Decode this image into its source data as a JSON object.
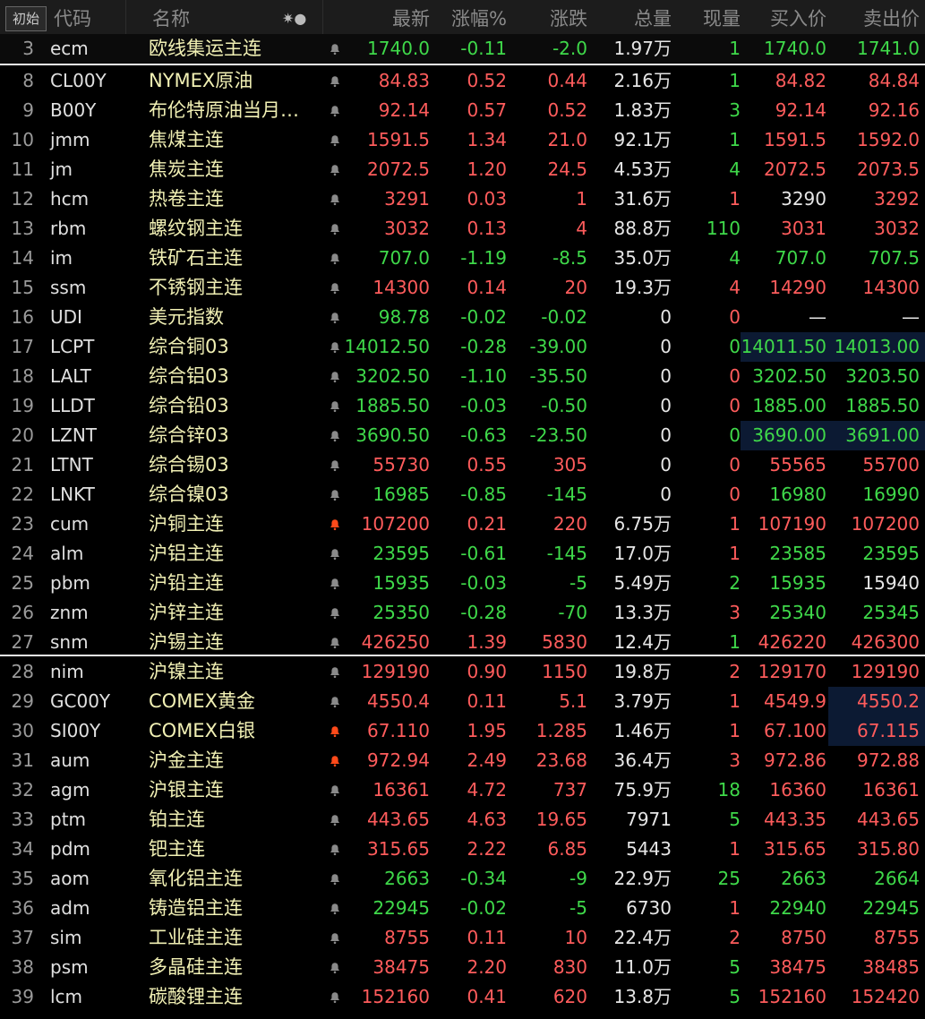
{
  "header": {
    "init_button": "初始",
    "col_code": "代码",
    "col_name": "名称",
    "col_flag": "✷●",
    "col_last": "最新",
    "col_pct": "涨幅%",
    "col_chg": "涨跌",
    "col_vol": "总量",
    "col_curvol": "现量",
    "col_bid": "买入价",
    "col_ask": "卖出价"
  },
  "colors": {
    "up": "#ff5c5c",
    "down": "#3fd94a",
    "name": "#f1f0b4",
    "alert_bell": "#ff4a1a"
  },
  "rows": [
    {
      "idx": "3",
      "code": "ecm",
      "name": "欧线集运主连",
      "bell": "normal",
      "last": "1740.0",
      "pct": "-0.11",
      "chg": "-2.0",
      "vol": "1.97万",
      "cur": "1",
      "bid": "1740.0",
      "ask": "1741.0",
      "c_last": "dn",
      "c_pct": "dn",
      "c_chg": "dn",
      "c_cur": "dn",
      "c_bid": "dn",
      "c_ask": "dn"
    },
    {
      "idx": "8",
      "code": "CL00Y",
      "name": "NYMEX原油",
      "bell": "normal",
      "last": "84.83",
      "pct": "0.52",
      "chg": "0.44",
      "vol": "2.16万",
      "cur": "1",
      "bid": "84.82",
      "ask": "84.84",
      "c_last": "up",
      "c_pct": "up",
      "c_chg": "up",
      "c_cur": "dn",
      "c_bid": "up",
      "c_ask": "up"
    },
    {
      "idx": "9",
      "code": "B00Y",
      "name": "布伦特原油当月…",
      "bell": "normal",
      "last": "92.14",
      "pct": "0.57",
      "chg": "0.52",
      "vol": "1.83万",
      "cur": "3",
      "bid": "92.14",
      "ask": "92.16",
      "c_last": "up",
      "c_pct": "up",
      "c_chg": "up",
      "c_cur": "dn",
      "c_bid": "up",
      "c_ask": "up"
    },
    {
      "idx": "10",
      "code": "jmm",
      "name": "焦煤主连",
      "bell": "normal",
      "last": "1591.5",
      "pct": "1.34",
      "chg": "21.0",
      "vol": "92.1万",
      "cur": "1",
      "bid": "1591.5",
      "ask": "1592.0",
      "c_last": "up",
      "c_pct": "up",
      "c_chg": "up",
      "c_cur": "dn",
      "c_bid": "up",
      "c_ask": "up"
    },
    {
      "idx": "11",
      "code": "jm",
      "name": "焦炭主连",
      "bell": "normal",
      "last": "2072.5",
      "pct": "1.20",
      "chg": "24.5",
      "vol": "4.53万",
      "cur": "4",
      "bid": "2072.5",
      "ask": "2073.5",
      "c_last": "up",
      "c_pct": "up",
      "c_chg": "up",
      "c_cur": "dn",
      "c_bid": "up",
      "c_ask": "up"
    },
    {
      "idx": "12",
      "code": "hcm",
      "name": "热卷主连",
      "bell": "normal",
      "last": "3291",
      "pct": "0.03",
      "chg": "1",
      "vol": "31.6万",
      "cur": "1",
      "bid": "3290",
      "ask": "3292",
      "c_last": "up",
      "c_pct": "up",
      "c_chg": "up",
      "c_cur": "up",
      "c_bid": "wh",
      "c_ask": "up"
    },
    {
      "idx": "13",
      "code": "rbm",
      "name": "螺纹钢主连",
      "bell": "normal",
      "last": "3032",
      "pct": "0.13",
      "chg": "4",
      "vol": "88.8万",
      "cur": "110",
      "bid": "3031",
      "ask": "3032",
      "c_last": "up",
      "c_pct": "up",
      "c_chg": "up",
      "c_cur": "dn",
      "c_bid": "up",
      "c_ask": "up"
    },
    {
      "idx": "14",
      "code": "im",
      "name": "铁矿石主连",
      "bell": "normal",
      "last": "707.0",
      "pct": "-1.19",
      "chg": "-8.5",
      "vol": "35.0万",
      "cur": "4",
      "bid": "707.0",
      "ask": "707.5",
      "c_last": "dn",
      "c_pct": "dn",
      "c_chg": "dn",
      "c_cur": "dn",
      "c_bid": "dn",
      "c_ask": "dn"
    },
    {
      "idx": "15",
      "code": "ssm",
      "name": "不锈钢主连",
      "bell": "normal",
      "last": "14300",
      "pct": "0.14",
      "chg": "20",
      "vol": "19.3万",
      "cur": "4",
      "bid": "14290",
      "ask": "14300",
      "c_last": "up",
      "c_pct": "up",
      "c_chg": "up",
      "c_cur": "up",
      "c_bid": "up",
      "c_ask": "up"
    },
    {
      "idx": "16",
      "code": "UDI",
      "name": "美元指数",
      "bell": "normal",
      "last": "98.78",
      "pct": "-0.02",
      "chg": "-0.02",
      "vol": "0",
      "cur": "0",
      "bid": "—",
      "ask": "—",
      "c_last": "dn",
      "c_pct": "dn",
      "c_chg": "dn",
      "c_cur": "up",
      "c_bid": "wh",
      "c_ask": "wh"
    },
    {
      "idx": "17",
      "code": "LCPT",
      "name": "综合铜03",
      "bell": "normal",
      "last": "14012.50",
      "pct": "-0.28",
      "chg": "-39.00",
      "vol": "0",
      "cur": "0",
      "bid": "14011.50",
      "ask": "14013.00",
      "c_last": "dn",
      "c_pct": "dn",
      "c_chg": "dn",
      "c_cur": "dn",
      "c_bid": "dn",
      "c_ask": "dn",
      "hl": true
    },
    {
      "idx": "18",
      "code": "LALT",
      "name": "综合铝03",
      "bell": "normal",
      "last": "3202.50",
      "pct": "-1.10",
      "chg": "-35.50",
      "vol": "0",
      "cur": "0",
      "bid": "3202.50",
      "ask": "3203.50",
      "c_last": "dn",
      "c_pct": "dn",
      "c_chg": "dn",
      "c_cur": "up",
      "c_bid": "dn",
      "c_ask": "dn"
    },
    {
      "idx": "19",
      "code": "LLDT",
      "name": "综合铅03",
      "bell": "normal",
      "last": "1885.50",
      "pct": "-0.03",
      "chg": "-0.50",
      "vol": "0",
      "cur": "0",
      "bid": "1885.00",
      "ask": "1885.50",
      "c_last": "dn",
      "c_pct": "dn",
      "c_chg": "dn",
      "c_cur": "up",
      "c_bid": "dn",
      "c_ask": "dn"
    },
    {
      "idx": "20",
      "code": "LZNT",
      "name": "综合锌03",
      "bell": "normal",
      "last": "3690.50",
      "pct": "-0.63",
      "chg": "-23.50",
      "vol": "0",
      "cur": "0",
      "bid": "3690.00",
      "ask": "3691.00",
      "c_last": "dn",
      "c_pct": "dn",
      "c_chg": "dn",
      "c_cur": "dn",
      "c_bid": "dn",
      "c_ask": "dn",
      "hl": true
    },
    {
      "idx": "21",
      "code": "LTNT",
      "name": "综合锡03",
      "bell": "normal",
      "last": "55730",
      "pct": "0.55",
      "chg": "305",
      "vol": "0",
      "cur": "0",
      "bid": "55565",
      "ask": "55700",
      "c_last": "up",
      "c_pct": "up",
      "c_chg": "up",
      "c_cur": "up",
      "c_bid": "up",
      "c_ask": "up"
    },
    {
      "idx": "22",
      "code": "LNKT",
      "name": "综合镍03",
      "bell": "normal",
      "last": "16985",
      "pct": "-0.85",
      "chg": "-145",
      "vol": "0",
      "cur": "0",
      "bid": "16980",
      "ask": "16990",
      "c_last": "dn",
      "c_pct": "dn",
      "c_chg": "dn",
      "c_cur": "up",
      "c_bid": "dn",
      "c_ask": "dn"
    },
    {
      "idx": "23",
      "code": "cum",
      "name": "沪铜主连",
      "bell": "alert",
      "last": "107200",
      "pct": "0.21",
      "chg": "220",
      "vol": "6.75万",
      "cur": "1",
      "bid": "107190",
      "ask": "107200",
      "c_last": "up",
      "c_pct": "up",
      "c_chg": "up",
      "c_cur": "up",
      "c_bid": "up",
      "c_ask": "up"
    },
    {
      "idx": "24",
      "code": "alm",
      "name": "沪铝主连",
      "bell": "normal",
      "last": "23595",
      "pct": "-0.61",
      "chg": "-145",
      "vol": "17.0万",
      "cur": "1",
      "bid": "23585",
      "ask": "23595",
      "c_last": "dn",
      "c_pct": "dn",
      "c_chg": "dn",
      "c_cur": "up",
      "c_bid": "dn",
      "c_ask": "dn"
    },
    {
      "idx": "25",
      "code": "pbm",
      "name": "沪铅主连",
      "bell": "normal",
      "last": "15935",
      "pct": "-0.03",
      "chg": "-5",
      "vol": "5.49万",
      "cur": "2",
      "bid": "15935",
      "ask": "15940",
      "c_last": "dn",
      "c_pct": "dn",
      "c_chg": "dn",
      "c_cur": "dn",
      "c_bid": "dn",
      "c_ask": "wh"
    },
    {
      "idx": "26",
      "code": "znm",
      "name": "沪锌主连",
      "bell": "normal",
      "last": "25350",
      "pct": "-0.28",
      "chg": "-70",
      "vol": "13.3万",
      "cur": "3",
      "bid": "25340",
      "ask": "25345",
      "c_last": "dn",
      "c_pct": "dn",
      "c_chg": "dn",
      "c_cur": "up",
      "c_bid": "dn",
      "c_ask": "dn"
    },
    {
      "idx": "27",
      "code": "snm",
      "name": "沪锡主连",
      "bell": "normal",
      "last": "426250",
      "pct": "1.39",
      "chg": "5830",
      "vol": "12.4万",
      "cur": "1",
      "bid": "426220",
      "ask": "426300",
      "c_last": "up",
      "c_pct": "up",
      "c_chg": "up",
      "c_cur": "dn",
      "c_bid": "up",
      "c_ask": "up"
    },
    {
      "idx": "28",
      "code": "nim",
      "name": "沪镍主连",
      "bell": "normal",
      "last": "129190",
      "pct": "0.90",
      "chg": "1150",
      "vol": "19.8万",
      "cur": "2",
      "bid": "129170",
      "ask": "129190",
      "c_last": "up",
      "c_pct": "up",
      "c_chg": "up",
      "c_cur": "up",
      "c_bid": "up",
      "c_ask": "up"
    },
    {
      "idx": "29",
      "code": "GC00Y",
      "name": "COMEX黄金",
      "bell": "normal",
      "last": "4550.4",
      "pct": "0.11",
      "chg": "5.1",
      "vol": "3.79万",
      "cur": "1",
      "bid": "4549.9",
      "ask": "4550.2",
      "c_last": "up",
      "c_pct": "up",
      "c_chg": "up",
      "c_cur": "up",
      "c_bid": "up",
      "c_ask": "up",
      "hl_ask": true
    },
    {
      "idx": "30",
      "code": "SI00Y",
      "name": "COMEX白银",
      "bell": "alert",
      "last": "67.110",
      "pct": "1.95",
      "chg": "1.285",
      "vol": "1.46万",
      "cur": "1",
      "bid": "67.100",
      "ask": "67.115",
      "c_last": "up",
      "c_pct": "up",
      "c_chg": "up",
      "c_cur": "up",
      "c_bid": "up",
      "c_ask": "up",
      "hl_ask": true
    },
    {
      "idx": "31",
      "code": "aum",
      "name": "沪金主连",
      "bell": "alert",
      "last": "972.94",
      "pct": "2.49",
      "chg": "23.68",
      "vol": "36.4万",
      "cur": "3",
      "bid": "972.86",
      "ask": "972.88",
      "c_last": "up",
      "c_pct": "up",
      "c_chg": "up",
      "c_cur": "up",
      "c_bid": "up",
      "c_ask": "up"
    },
    {
      "idx": "32",
      "code": "agm",
      "name": "沪银主连",
      "bell": "normal",
      "last": "16361",
      "pct": "4.72",
      "chg": "737",
      "vol": "75.9万",
      "cur": "18",
      "bid": "16360",
      "ask": "16361",
      "c_last": "up",
      "c_pct": "up",
      "c_chg": "up",
      "c_cur": "dn",
      "c_bid": "up",
      "c_ask": "up"
    },
    {
      "idx": "33",
      "code": "ptm",
      "name": "铂主连",
      "bell": "normal",
      "last": "443.65",
      "pct": "4.63",
      "chg": "19.65",
      "vol": "7971",
      "cur": "5",
      "bid": "443.35",
      "ask": "443.65",
      "c_last": "up",
      "c_pct": "up",
      "c_chg": "up",
      "c_cur": "dn",
      "c_bid": "up",
      "c_ask": "up"
    },
    {
      "idx": "34",
      "code": "pdm",
      "name": "钯主连",
      "bell": "normal",
      "last": "315.65",
      "pct": "2.22",
      "chg": "6.85",
      "vol": "5443",
      "cur": "1",
      "bid": "315.65",
      "ask": "315.80",
      "c_last": "up",
      "c_pct": "up",
      "c_chg": "up",
      "c_cur": "up",
      "c_bid": "up",
      "c_ask": "up"
    },
    {
      "idx": "35",
      "code": "aom",
      "name": "氧化铝主连",
      "bell": "normal",
      "last": "2663",
      "pct": "-0.34",
      "chg": "-9",
      "vol": "22.9万",
      "cur": "25",
      "bid": "2663",
      "ask": "2664",
      "c_last": "dn",
      "c_pct": "dn",
      "c_chg": "dn",
      "c_cur": "dn",
      "c_bid": "dn",
      "c_ask": "dn"
    },
    {
      "idx": "36",
      "code": "adm",
      "name": "铸造铝主连",
      "bell": "normal",
      "last": "22945",
      "pct": "-0.02",
      "chg": "-5",
      "vol": "6730",
      "cur": "1",
      "bid": "22940",
      "ask": "22945",
      "c_last": "dn",
      "c_pct": "dn",
      "c_chg": "dn",
      "c_cur": "up",
      "c_bid": "dn",
      "c_ask": "dn"
    },
    {
      "idx": "37",
      "code": "sim",
      "name": "工业硅主连",
      "bell": "normal",
      "last": "8755",
      "pct": "0.11",
      "chg": "10",
      "vol": "22.4万",
      "cur": "2",
      "bid": "8750",
      "ask": "8755",
      "c_last": "up",
      "c_pct": "up",
      "c_chg": "up",
      "c_cur": "up",
      "c_bid": "up",
      "c_ask": "up"
    },
    {
      "idx": "38",
      "code": "psm",
      "name": "多晶硅主连",
      "bell": "normal",
      "last": "38475",
      "pct": "2.20",
      "chg": "830",
      "vol": "11.0万",
      "cur": "5",
      "bid": "38475",
      "ask": "38485",
      "c_last": "up",
      "c_pct": "up",
      "c_chg": "up",
      "c_cur": "dn",
      "c_bid": "up",
      "c_ask": "up"
    },
    {
      "idx": "39",
      "code": "lcm",
      "name": "碳酸锂主连",
      "bell": "normal",
      "last": "152160",
      "pct": "0.41",
      "chg": "620",
      "vol": "13.8万",
      "cur": "5",
      "bid": "152160",
      "ask": "152420",
      "c_last": "up",
      "c_pct": "up",
      "c_chg": "up",
      "c_cur": "dn",
      "c_bid": "up",
      "c_ask": "up"
    }
  ]
}
